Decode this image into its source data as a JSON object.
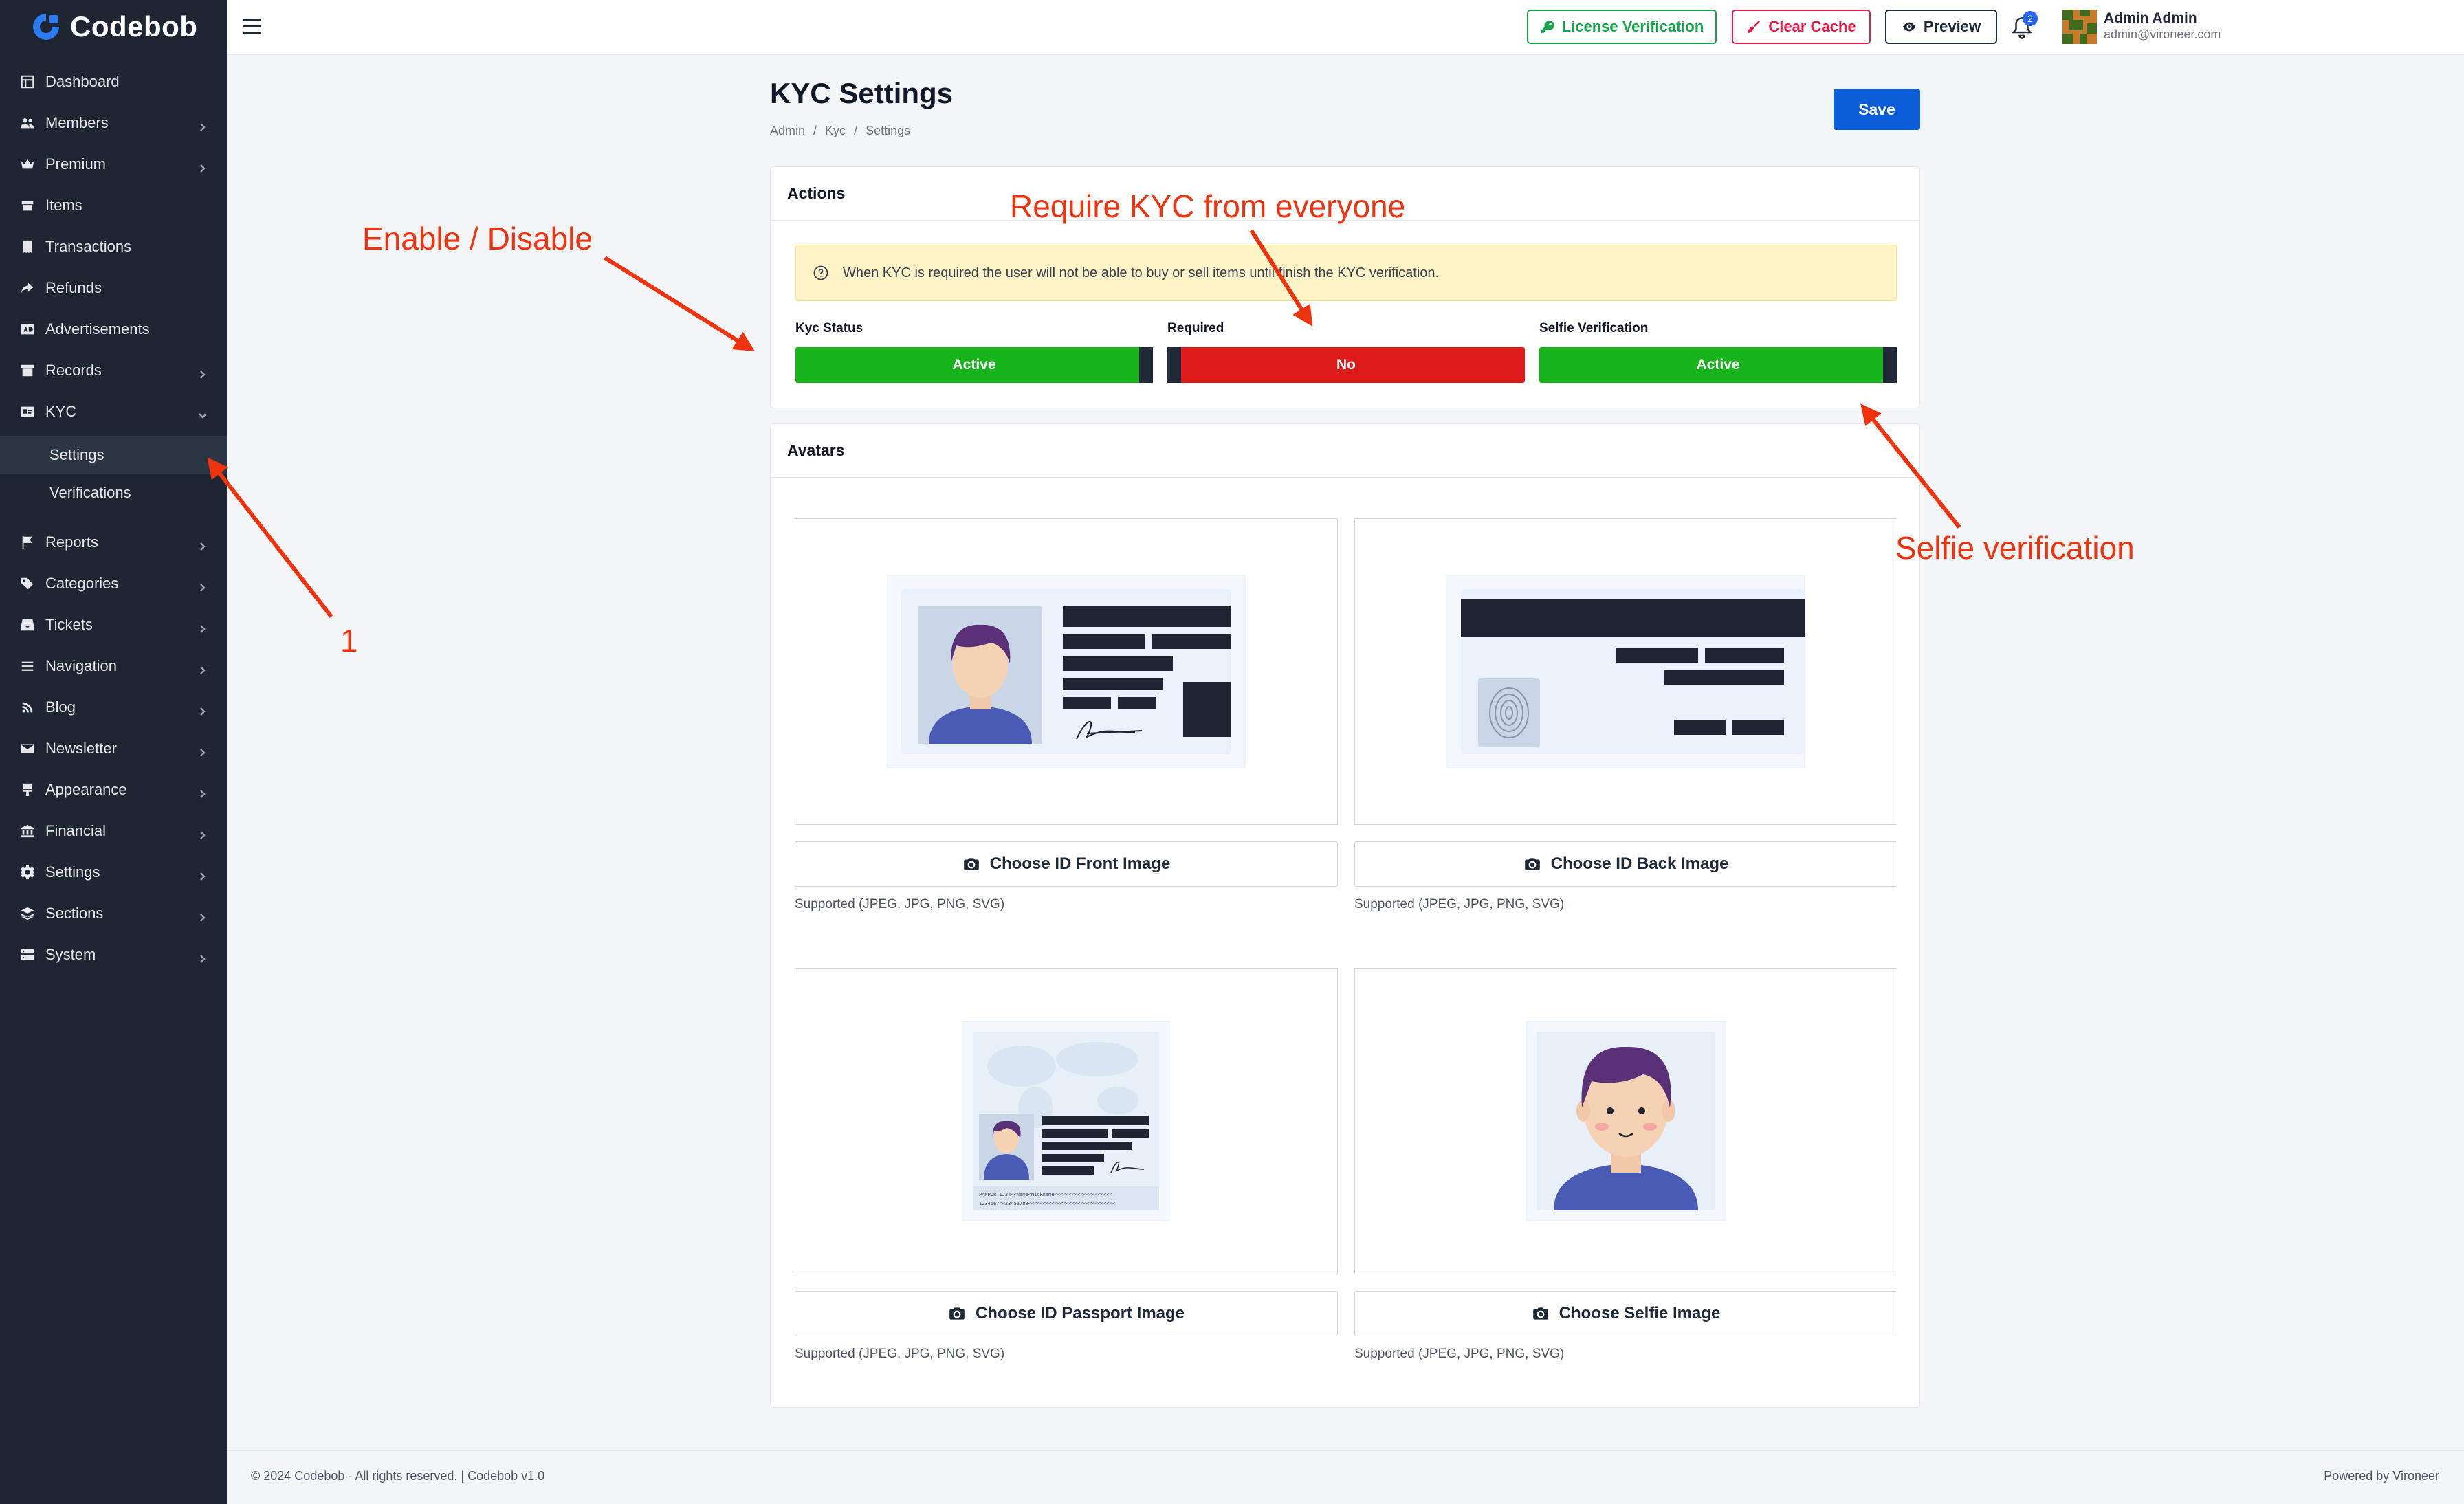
{
  "app": {
    "name": "Codebob"
  },
  "sidebar": {
    "items": [
      {
        "label": "Dashboard",
        "icon": "dashboard-icon",
        "chevron": false
      },
      {
        "label": "Members",
        "icon": "users-icon",
        "chevron": true
      },
      {
        "label": "Premium",
        "icon": "crown-icon",
        "chevron": true
      },
      {
        "label": "Items",
        "icon": "box-icon",
        "chevron": false
      },
      {
        "label": "Transactions",
        "icon": "receipt-icon",
        "chevron": false
      },
      {
        "label": "Refunds",
        "icon": "share-icon",
        "chevron": false
      },
      {
        "label": "Advertisements",
        "icon": "ad-icon",
        "chevron": false
      },
      {
        "label": "Records",
        "icon": "archive-icon",
        "chevron": true
      },
      {
        "label": "KYC",
        "icon": "id-card-icon",
        "chevron": true,
        "expanded": true
      },
      {
        "label": "Reports",
        "icon": "flag-icon",
        "chevron": true
      },
      {
        "label": "Categories",
        "icon": "tags-icon",
        "chevron": true
      },
      {
        "label": "Tickets",
        "icon": "inbox-icon",
        "chevron": true
      },
      {
        "label": "Navigation",
        "icon": "bars-icon",
        "chevron": true
      },
      {
        "label": "Blog",
        "icon": "rss-icon",
        "chevron": true
      },
      {
        "label": "Newsletter",
        "icon": "mail-icon",
        "chevron": true
      },
      {
        "label": "Appearance",
        "icon": "brush-icon",
        "chevron": true
      },
      {
        "label": "Financial",
        "icon": "bank-icon",
        "chevron": true
      },
      {
        "label": "Settings",
        "icon": "gear-icon",
        "chevron": true
      },
      {
        "label": "Sections",
        "icon": "layers-icon",
        "chevron": true
      },
      {
        "label": "System",
        "icon": "server-icon",
        "chevron": true
      }
    ],
    "kyc_sub": [
      {
        "label": "Settings",
        "active": true
      },
      {
        "label": "Verifications",
        "active": false
      }
    ]
  },
  "topbar": {
    "license_label": "License Verification",
    "cache_label": "Clear Cache",
    "preview_label": "Preview",
    "notifications_count": "2",
    "user_name": "Admin Admin",
    "user_email": "admin@vironeer.com"
  },
  "page": {
    "title": "KYC Settings",
    "breadcrumb": [
      "Admin",
      "Kyc",
      "Settings"
    ],
    "save_label": "Save"
  },
  "actions": {
    "heading": "Actions",
    "alert": "When KYC is required the user will not be able to buy or sell items until finish the KYC verification.",
    "toggles": [
      {
        "label": "Kyc Status",
        "value": "Active",
        "on": true
      },
      {
        "label": "Required",
        "value": "No",
        "on": false
      },
      {
        "label": "Selfie Verification",
        "value": "Active",
        "on": true
      }
    ]
  },
  "avatars": {
    "heading": "Avatars",
    "items": [
      {
        "button": "Choose ID Front Image",
        "supported": "Supported (JPEG, JPG, PNG, SVG)"
      },
      {
        "button": "Choose ID Back Image",
        "supported": "Supported (JPEG, JPG, PNG, SVG)"
      },
      {
        "button": "Choose ID Passport Image",
        "supported": "Supported (JPEG, JPG, PNG, SVG)"
      },
      {
        "button": "Choose Selfie Image",
        "supported": "Supported (JPEG, JPG, PNG, SVG)"
      }
    ],
    "passport_mrz": [
      "PANPORT1234<<Name<Nickname<<<<<<<<<<<<<<<<<<<<",
      "1234567<<23456789<<<<<<<<<<<<<<<<<<<<<<<<<<<<<<"
    ]
  },
  "annotations": {
    "enable_disable": "Enable / Disable",
    "require_kyc": "Require KYC from everyone",
    "selfie": "Selfie verification",
    "step": "1"
  },
  "footer": {
    "left": "© 2024 Codebob - All rights reserved. | Codebob v1.0",
    "right": "Powered by Vironeer"
  },
  "colors": {
    "sidebar_bg": "#1e2633",
    "primary": "#0b5ed7",
    "active_green": "#16b31a",
    "inactive_red": "#dc1a1a",
    "annotation_red": "#f0330f"
  }
}
